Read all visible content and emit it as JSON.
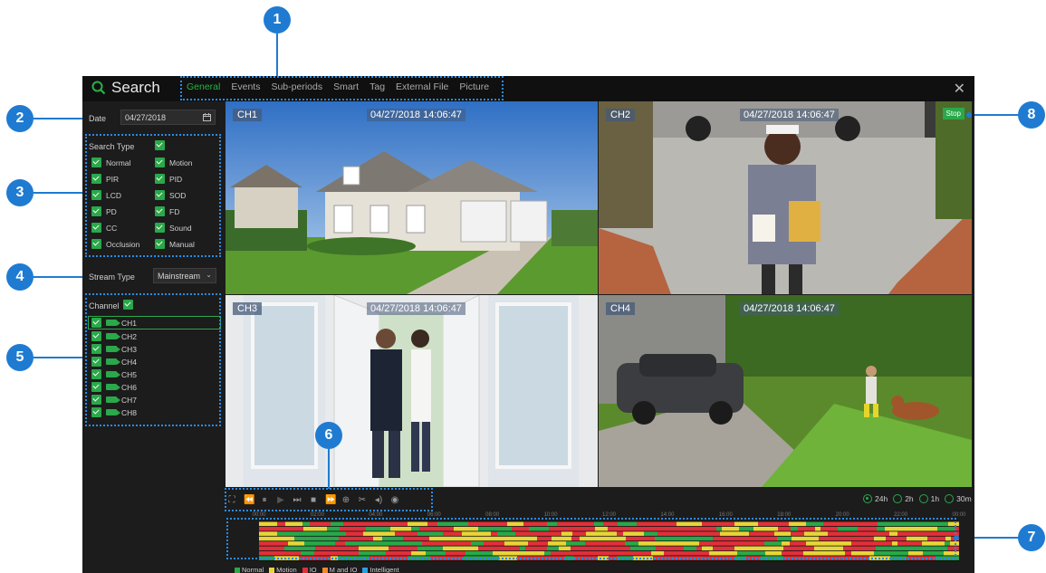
{
  "window": {
    "title": "Search",
    "close_icon": "close-icon"
  },
  "tabs": [
    {
      "label": "General",
      "active": true
    },
    {
      "label": "Events",
      "active": false
    },
    {
      "label": "Sub-periods",
      "active": false
    },
    {
      "label": "Smart",
      "active": false
    },
    {
      "label": "Tag",
      "active": false
    },
    {
      "label": "External File",
      "active": false
    },
    {
      "label": "Picture",
      "active": false
    }
  ],
  "callouts": [
    "1",
    "2",
    "3",
    "4",
    "5",
    "6",
    "7",
    "8"
  ],
  "sidebar": {
    "date_label": "Date",
    "date_value": "04/27/2018",
    "search_type_label": "Search Type",
    "search_types": [
      "Normal",
      "Motion",
      "PIR",
      "PID",
      "LCD",
      "SOD",
      "PD",
      "FD",
      "CC",
      "Sound",
      "Occlusion",
      "Manual"
    ],
    "stream_type_label": "Stream Type",
    "stream_type_value": "Mainstream",
    "channel_label": "Channel",
    "channels": [
      "CH1",
      "CH2",
      "CH3",
      "CH4",
      "CH5",
      "CH6",
      "CH7",
      "CH8"
    ]
  },
  "video": [
    {
      "label": "CH1",
      "time": "04/27/2018 14:06:47"
    },
    {
      "label": "CH2",
      "time": "04/27/2018 14:06:47",
      "stop": "Stop"
    },
    {
      "label": "CH3",
      "time": "04/27/2018 14:06:47"
    },
    {
      "label": "CH4",
      "time": "04/27/2018 14:06:47"
    }
  ],
  "controls": [
    "fullscreen-icon",
    "rewind-icon",
    "slow-icon",
    "play-icon",
    "next-frame-icon",
    "stop-icon",
    "fast-forward-icon",
    "zoom-icon",
    "clip-icon",
    "audio-icon",
    "snapshot-icon"
  ],
  "zoom_options": [
    {
      "label": "24h",
      "selected": true
    },
    {
      "label": "2h",
      "selected": false
    },
    {
      "label": "1h",
      "selected": false
    },
    {
      "label": "30m",
      "selected": false
    }
  ],
  "timeline_ticks": [
    "00:00",
    "02:00",
    "04:00",
    "06:00",
    "08:00",
    "10:00",
    "12:00",
    "14:00",
    "16:00",
    "18:00",
    "20:00",
    "22:00",
    "00:00"
  ],
  "legend": [
    {
      "label": "Normal",
      "color": "#2aa84a"
    },
    {
      "label": "Motion",
      "color": "#e8d53a"
    },
    {
      "label": "IO",
      "color": "#e0303a"
    },
    {
      "label": "M and IO",
      "color": "#f08a24"
    },
    {
      "label": "Intelligent",
      "color": "#2a9fe0"
    }
  ]
}
